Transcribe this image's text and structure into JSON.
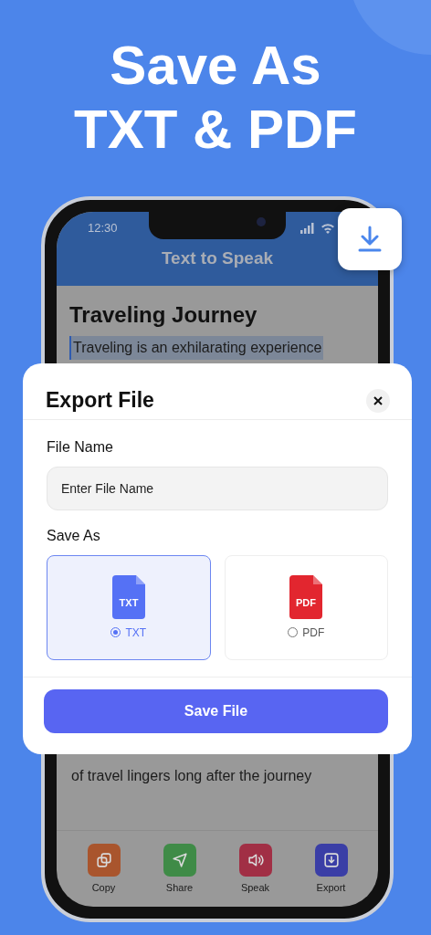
{
  "headline": [
    "Save As",
    "TXT & PDF"
  ],
  "status_bar": {
    "time": "12:30"
  },
  "app_bar": {
    "title": "Text to Speak"
  },
  "document": {
    "title": "Traveling Journey",
    "lines": [
      {
        "text": "Traveling is an exhilarating experience",
        "selected": true
      },
      {
        "text": "of travel lingers long after the journey",
        "selected": false
      }
    ]
  },
  "toolbar": [
    {
      "label": "Copy",
      "kind": "copy",
      "color": "#a9552d"
    },
    {
      "label": "Share",
      "kind": "share",
      "color": "#3f8b47"
    },
    {
      "label": "Speak",
      "kind": "speak",
      "color": "#a12f45"
    },
    {
      "label": "Export",
      "kind": "export",
      "color": "#3a3ea6"
    }
  ],
  "dialog": {
    "title": "Export File",
    "field": {
      "label": "File Name",
      "placeholder": "Enter File Name"
    },
    "save_as_label": "Save As",
    "formats": [
      {
        "label": "TXT",
        "badge": "TXT",
        "selected": true,
        "color": "#5571f5"
      },
      {
        "label": "PDF",
        "badge": "PDF",
        "selected": false,
        "color": "#e2262f"
      }
    ],
    "button": "Save File"
  }
}
